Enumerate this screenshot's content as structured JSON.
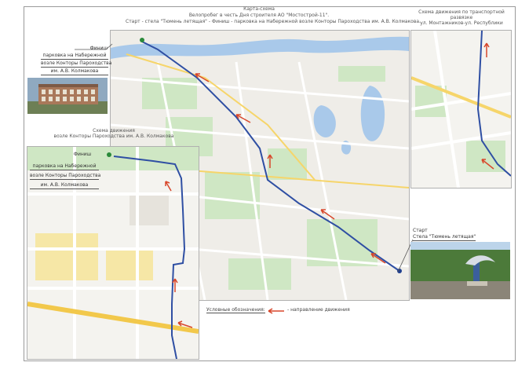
{
  "title": {
    "line1": "Карта-схема",
    "line2": "Велопробег в честь Дня строителя АО \"Мостострой-11\".",
    "line3": "Старт - стела \"Тюмень летящая\" - Финиш - парковка на Набережной возле Конторы Пароходства им. А.В. Колмакова."
  },
  "finish_main": {
    "heading": "Финиш",
    "line1": "парковка на Набережной",
    "line2": "возле Конторы Пароходства",
    "line3": "им. А.В. Колмакова"
  },
  "inset_left_title": {
    "line1": "Схема движения",
    "line2": "возле Конторы Пароходства им. А.В. Колмакова"
  },
  "finish_inset": {
    "heading": "Финиш",
    "line1": "парковка на Набережной",
    "line2": "возле Конторы Пароходства",
    "line3": "им. А.В. Колмакова"
  },
  "inset_right_title": {
    "line1": "Схема движения по транспортной развязке",
    "line2": "ул. Монтажников-ул. Республики"
  },
  "start": {
    "heading": "Старт",
    "line1": "Стела \"Тюмень летящая\""
  },
  "legend": {
    "label": "Условные обозначения:",
    "arrow_text": "- направление движения"
  },
  "colors": {
    "route": "#2f4fa3",
    "arrow": "#d8472b",
    "river": "#a9c9ea",
    "green": "#cfe7c4",
    "road": "#ffffff",
    "yellow_road": "#f6d56a",
    "map_bg": "#efede8"
  },
  "icons": {
    "route_arrow": "red-arrow-icon",
    "finish_marker": "green-pin-icon",
    "start_marker": "route-end-icon"
  }
}
